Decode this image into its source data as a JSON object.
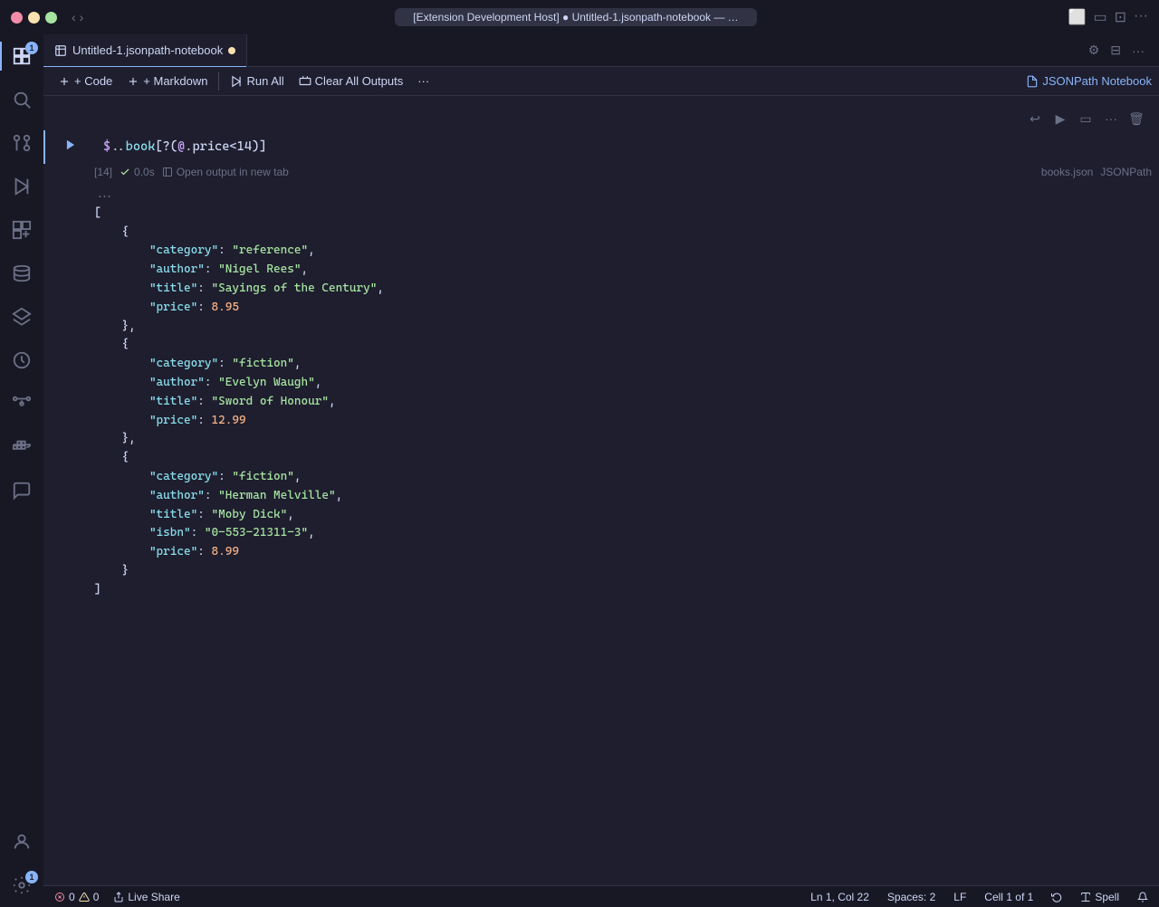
{
  "titlebar": {
    "address": "[Extension Development Host] ● Untitled-1.jsonpath-notebook — …",
    "nav_back": "‹",
    "nav_forward": "›"
  },
  "tab": {
    "icon": "📓",
    "filename": "Untitled-1.jsonpath-notebook",
    "modified": true
  },
  "notebook": {
    "extension_label": "JSONPath Notebook",
    "toolbar": {
      "add_code": "+ Code",
      "add_markdown": "+ Markdown",
      "run_all": "Run All",
      "clear_all": "Clear All Outputs",
      "more": "···"
    }
  },
  "cell": {
    "number": "[14]",
    "time": "0.0s",
    "output_link": "Open output in new tab",
    "source_file": "books.json",
    "language": "JSONPath",
    "expression": "$..book[?(@.price<14)]",
    "run_icon": "▶"
  },
  "output": {
    "lines": [
      "...",
      "[",
      "    {",
      "        \"category\": \"reference\",",
      "        \"author\": \"Nigel Rees\",",
      "        \"title\": \"Sayings of the Century\",",
      "        \"price\": 8.95",
      "    },",
      "    {",
      "        \"category\": \"fiction\",",
      "        \"author\": \"Evelyn Waugh\",",
      "        \"title\": \"Sword of Honour\",",
      "        \"price\": 12.99",
      "    },",
      "    {",
      "        \"category\": \"fiction\",",
      "        \"author\": \"Herman Melville\",",
      "        \"title\": \"Moby Dick\",",
      "        \"isbn\": \"0-553-21311-3\",",
      "        \"price\": 8.99",
      "    }",
      "]"
    ]
  },
  "status_bar": {
    "errors": "0",
    "warnings": "0",
    "live_share": "Live Share",
    "position": "Ln 1, Col 22",
    "spaces": "Spaces: 2",
    "encoding": "LF",
    "cell_info": "Cell 1 of 1",
    "spell": "Spell"
  },
  "activity_bar": {
    "items": [
      {
        "name": "explorer-icon",
        "label": "Explorer",
        "active": true,
        "badge": "1"
      },
      {
        "name": "search-icon",
        "label": "Search",
        "active": false
      },
      {
        "name": "source-control-icon",
        "label": "Source Control",
        "active": false
      },
      {
        "name": "run-icon",
        "label": "Run and Debug",
        "active": false
      },
      {
        "name": "extensions-icon",
        "label": "Extensions",
        "active": false
      },
      {
        "name": "database-icon",
        "label": "Database",
        "active": false
      },
      {
        "name": "layers-icon",
        "label": "Layers",
        "active": false
      },
      {
        "name": "history-icon",
        "label": "History",
        "active": false
      },
      {
        "name": "git-icon",
        "label": "Git",
        "active": false
      },
      {
        "name": "docker-icon",
        "label": "Docker",
        "active": false
      },
      {
        "name": "chat-icon",
        "label": "Chat",
        "active": false
      }
    ],
    "bottom_items": [
      {
        "name": "account-icon",
        "label": "Account"
      },
      {
        "name": "settings-icon",
        "label": "Settings",
        "badge": "1"
      }
    ]
  }
}
